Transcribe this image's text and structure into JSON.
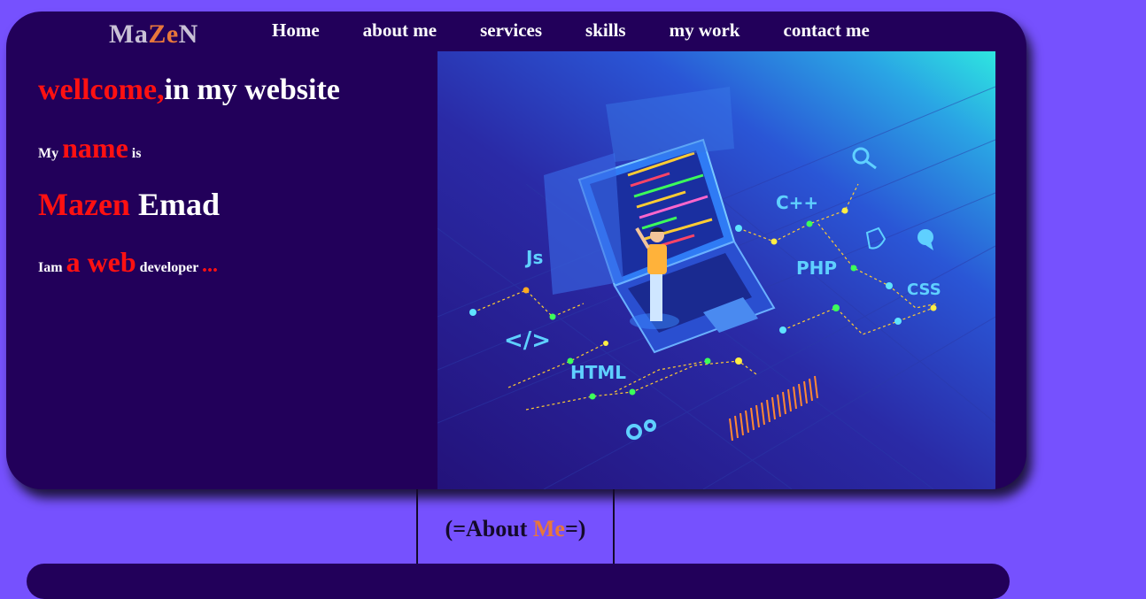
{
  "brand": {
    "logo_part1": "Ma",
    "logo_accent": "Ze",
    "logo_part2": "N"
  },
  "nav": {
    "items": [
      {
        "label": "Home"
      },
      {
        "label": "about me"
      },
      {
        "label": "services"
      },
      {
        "label": "skills"
      },
      {
        "label": "my work"
      },
      {
        "label": "contact me"
      }
    ]
  },
  "hero": {
    "welcome_red": "wellcome,",
    "welcome_rest": "in my website",
    "my_label": "My",
    "name_word": "name",
    "is_word": "is",
    "first_name": "Mazen",
    "last_name": "Emad",
    "iam": "Iam",
    "a_web": "a web",
    "developer": "developer",
    "dots": "..."
  },
  "illustration": {
    "tech_labels": [
      "Js",
      "C++",
      "PHP",
      "CSS",
      "HTML",
      "</>"
    ]
  },
  "about_section": {
    "open": "(=About ",
    "accent": "Me",
    "close": "=)"
  },
  "colors": {
    "page_background": "#7651fe",
    "hero_background": "#22005a",
    "accent_red": "#ff1111",
    "accent_orange": "#e8773b",
    "text_white": "#ffffff"
  }
}
